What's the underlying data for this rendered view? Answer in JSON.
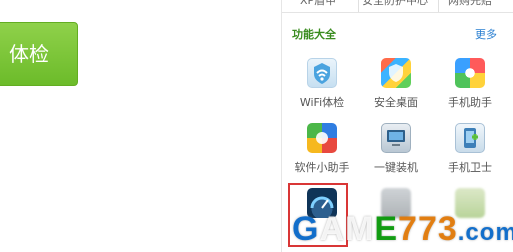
{
  "left_button": {
    "label": "体检"
  },
  "top_tabs": [
    "XP盾甲",
    "安全防护中心",
    "网购先赔"
  ],
  "section": {
    "title": "功能大全",
    "more": "更多"
  },
  "tiles": [
    {
      "icon": "wifi-check-icon",
      "label": "WiFi体检"
    },
    {
      "icon": "safe-desktop-icon",
      "label": "安全桌面"
    },
    {
      "icon": "phone-assistant-icon",
      "label": "手机助手"
    },
    {
      "icon": "software-helper-icon",
      "label": "软件小助手"
    },
    {
      "icon": "one-click-install-icon",
      "label": "一键装机"
    },
    {
      "icon": "phone-guard-icon",
      "label": "手机卫士"
    },
    {
      "icon": "speedometer-icon",
      "label": ""
    },
    {
      "icon": "blurred-app-icon",
      "label": ""
    },
    {
      "icon": "blurred-app-icon",
      "label": ""
    }
  ],
  "watermark": {
    "text_g": "G",
    "text_a": "A",
    "text_m": "M",
    "text_e": "E",
    "text_n": "773",
    "text_com": ".com"
  },
  "colors": {
    "accent_green": "#6cbb2a",
    "section_green": "#3a8c1f",
    "link_blue": "#2a7fd1",
    "selection_red": "#d93636"
  }
}
